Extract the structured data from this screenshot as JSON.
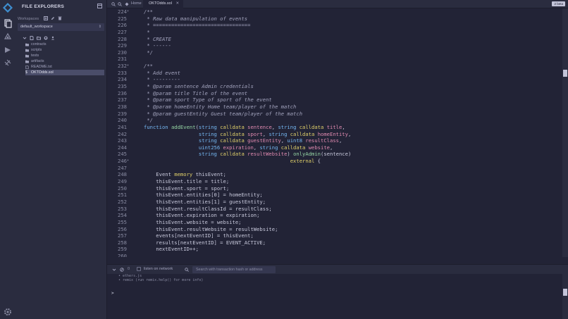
{
  "explorer": {
    "title": "FILE EXPLORERS",
    "workspaces_label": "Workspaces",
    "workspace_selected": "default_workspace",
    "tree": [
      {
        "name": "contracts",
        "type": "folder"
      },
      {
        "name": "scripts",
        "type": "folder"
      },
      {
        "name": "tests",
        "type": "folder"
      },
      {
        "name": "artifacts",
        "type": "folder"
      },
      {
        "name": "README.txt",
        "type": "file"
      },
      {
        "name": "OKTOdds.sol",
        "type": "sol",
        "active": true
      }
    ]
  },
  "tabs": {
    "home_label": "Home",
    "file_label": "OKTOdds.sol",
    "close_glyph": "✕",
    "badge": "2 beta"
  },
  "code": [
    {
      "n": "224",
      "fold": "▾",
      "t": [
        [
          "cm",
          "/**"
        ]
      ]
    },
    {
      "n": "225",
      "t": [
        [
          "cm",
          " * Raw data manipulation of events"
        ]
      ]
    },
    {
      "n": "226",
      "t": [
        [
          "cm",
          " * ================================"
        ]
      ]
    },
    {
      "n": "227",
      "t": [
        [
          "cm",
          " *"
        ]
      ]
    },
    {
      "n": "228",
      "t": [
        [
          "cm",
          " * CREATE"
        ]
      ]
    },
    {
      "n": "229",
      "t": [
        [
          "cm",
          " * ------"
        ]
      ]
    },
    {
      "n": "230",
      "t": [
        [
          "cm",
          " */"
        ]
      ]
    },
    {
      "n": "231",
      "t": []
    },
    {
      "n": "232",
      "fold": "▾",
      "t": [
        [
          "cm",
          "/**"
        ]
      ]
    },
    {
      "n": "233",
      "t": [
        [
          "cm",
          " * Add event"
        ]
      ]
    },
    {
      "n": "234",
      "t": [
        [
          "cm",
          " * ---------"
        ]
      ]
    },
    {
      "n": "235",
      "t": [
        [
          "cm",
          " * @param sentence Admin credentials"
        ]
      ]
    },
    {
      "n": "236",
      "t": [
        [
          "cm",
          " * @param title Title of the event"
        ]
      ]
    },
    {
      "n": "237",
      "t": [
        [
          "cm",
          " * @param sport Type of sport of the event"
        ]
      ]
    },
    {
      "n": "238",
      "t": [
        [
          "cm",
          " * @param homeEntity Home team/player of the match"
        ]
      ]
    },
    {
      "n": "239",
      "t": [
        [
          "cm",
          " * @param guestEntity Guest team/player of the match"
        ]
      ]
    },
    {
      "n": "240",
      "t": [
        [
          "cm",
          " */"
        ]
      ]
    },
    {
      "n": "241",
      "t": [
        [
          "kw",
          "function "
        ],
        [
          "fn",
          "addEvent"
        ],
        [
          "pl",
          "("
        ],
        [
          "kw",
          "string "
        ],
        [
          "dt",
          "calldata "
        ],
        [
          "pr",
          "sentence"
        ],
        [
          "pl",
          ", "
        ],
        [
          "kw",
          "string "
        ],
        [
          "dt",
          "calldata "
        ],
        [
          "pr",
          "title"
        ],
        [
          "pl",
          ","
        ]
      ]
    },
    {
      "n": "242",
      "t": [
        [
          "pl",
          "                  "
        ],
        [
          "kw",
          "string "
        ],
        [
          "dt",
          "calldata "
        ],
        [
          "pr",
          "sport"
        ],
        [
          "pl",
          ", "
        ],
        [
          "kw",
          "string "
        ],
        [
          "dt",
          "calldata "
        ],
        [
          "pr",
          "homeEntity"
        ],
        [
          "pl",
          ","
        ]
      ]
    },
    {
      "n": "243",
      "t": [
        [
          "pl",
          "                  "
        ],
        [
          "kw",
          "string "
        ],
        [
          "dt",
          "calldata "
        ],
        [
          "pr",
          "guestEntity"
        ],
        [
          "pl",
          ", "
        ],
        [
          "kw",
          "uint8 "
        ],
        [
          "pr",
          "resultClass"
        ],
        [
          "pl",
          ","
        ]
      ]
    },
    {
      "n": "244",
      "t": [
        [
          "pl",
          "                  "
        ],
        [
          "kw",
          "uint256 "
        ],
        [
          "pr",
          "expiration"
        ],
        [
          "pl",
          ", "
        ],
        [
          "kw",
          "string "
        ],
        [
          "dt",
          "calldata "
        ],
        [
          "pr",
          "website"
        ],
        [
          "pl",
          ","
        ]
      ]
    },
    {
      "n": "245",
      "t": [
        [
          "pl",
          "                  "
        ],
        [
          "kw",
          "string "
        ],
        [
          "dt",
          "calldata "
        ],
        [
          "pr",
          "resultWebsite"
        ],
        [
          "pl",
          ") "
        ],
        [
          "fn",
          "onlyAdmin"
        ],
        [
          "pl",
          "(sentence)"
        ]
      ]
    },
    {
      "n": "246",
      "fold": "▾",
      "t": [
        [
          "pl",
          "                                                "
        ],
        [
          "dt",
          "external "
        ],
        [
          "pl",
          "{"
        ]
      ]
    },
    {
      "n": "247",
      "t": []
    },
    {
      "n": "248",
      "t": [
        [
          "pl",
          "    Event "
        ],
        [
          "dt",
          "memory "
        ],
        [
          "pl",
          "thisEvent;"
        ]
      ]
    },
    {
      "n": "249",
      "t": [
        [
          "pl",
          "    thisEvent.title = title;"
        ]
      ]
    },
    {
      "n": "250",
      "t": [
        [
          "pl",
          "    thisEvent.sport = sport;"
        ]
      ]
    },
    {
      "n": "251",
      "t": [
        [
          "pl",
          "    thisEvent.entities[0] = homeEntity;"
        ]
      ]
    },
    {
      "n": "252",
      "t": [
        [
          "pl",
          "    thisEvent.entities[1] = guestEntity;"
        ]
      ]
    },
    {
      "n": "253",
      "t": [
        [
          "pl",
          "    thisEvent.resultClassId = resultClass;"
        ]
      ]
    },
    {
      "n": "254",
      "t": [
        [
          "pl",
          "    thisEvent.expiration = expiration;"
        ]
      ]
    },
    {
      "n": "255",
      "t": [
        [
          "pl",
          "    thisEvent.website = website;"
        ]
      ]
    },
    {
      "n": "256",
      "t": [
        [
          "pl",
          "    thisEvent.resultWebsite = resultWebsite;"
        ]
      ]
    },
    {
      "n": "257",
      "t": [
        [
          "pl",
          "    events[nextEventID] = thisEvent;"
        ]
      ]
    },
    {
      "n": "258",
      "t": [
        [
          "pl",
          "    results[nextEventID] = EVENT_ACTIVE;"
        ]
      ]
    },
    {
      "n": "259",
      "t": [
        [
          "pl",
          "    nextEventID++;"
        ]
      ]
    },
    {
      "n": "260",
      "t": []
    }
  ],
  "terminal": {
    "count": "0",
    "listen_label": "listen on network",
    "search_placeholder": "Search with transaction hash or address",
    "lines": [
      "• ethers.js",
      "• remix (run remix.help() for more info)"
    ],
    "prompt": ">"
  },
  "colors": {
    "background": "#222336",
    "panel": "#2a2c3f",
    "keyword": "#75b7f2",
    "datatype": "#e0d06a",
    "param": "#e08ab0",
    "function": "#95d5a4",
    "comment": "#a2a3bd"
  }
}
